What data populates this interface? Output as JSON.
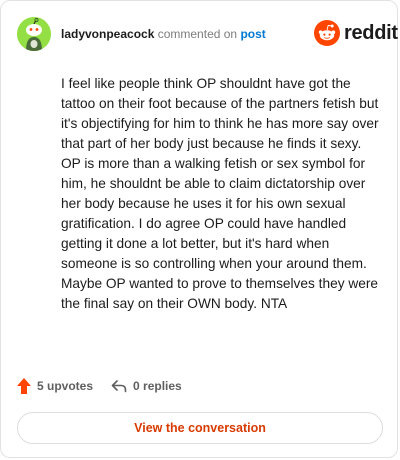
{
  "comment": {
    "username": "ladyvonpeacock",
    "action_text": "commented on",
    "target": "post",
    "body": "I feel like people think OP shouldnt have got the tattoo on their foot because of the partners fetish but it's objectifying for him to think he has more say over that part of her body just because he finds it sexy. OP is more than a walking fetish or sex symbol for him, he shouldnt be able to claim dictatorship over her body because he uses it for his own sexual gratification. I do agree OP could have handled getting it done a lot better, but it's hard when someone is so controlling when your around them. Maybe OP wanted to prove to themselves they were the final say on their OWN body. NTA"
  },
  "brand": {
    "logo_text": "reddit",
    "accent": "#ff4500"
  },
  "stats": {
    "upvotes": "5 upvotes",
    "replies": "0 replies"
  },
  "cta": {
    "label": "View the conversation"
  },
  "icons": {
    "avatar": "snoo-avatar-icon",
    "logo": "reddit-alien-icon",
    "upvote": "upvote-arrow-icon",
    "reply": "reply-arrow-icon"
  },
  "colors": {
    "avatar_bg": "#94e044",
    "link": "#0079d3",
    "cta_text": "#d93a00",
    "upvote": "#ff4500"
  }
}
